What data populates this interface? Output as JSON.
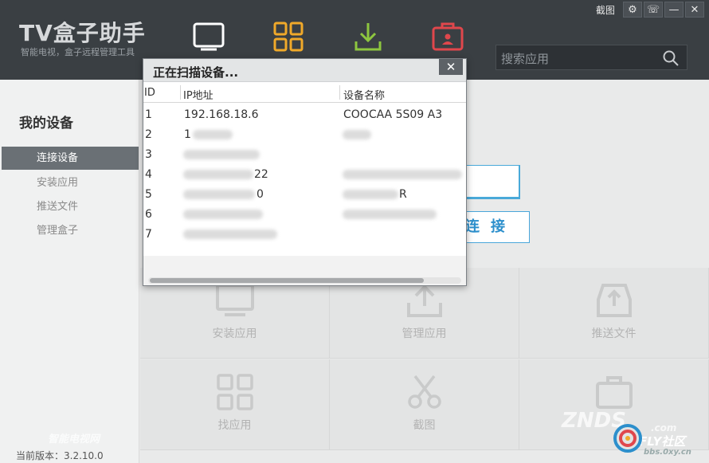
{
  "app": {
    "title": "TV盒子助手",
    "subtitle": "智能电视，盒子远程管理工具"
  },
  "window_controls": {
    "screenshot_label": "截图",
    "settings": "⚙",
    "feedback": "☏",
    "minimize": "—",
    "close": "✕"
  },
  "search": {
    "placeholder": "搜索应用"
  },
  "sidebar": {
    "title": "我的设备",
    "items": [
      {
        "label": "连接设备",
        "active": true
      },
      {
        "label": "安装应用",
        "active": false
      },
      {
        "label": "推送文件",
        "active": false
      },
      {
        "label": "管理盒子",
        "active": false
      }
    ],
    "version": "当前版本：3.2.10.0"
  },
  "main": {
    "connect_label": "连接",
    "tiles": [
      {
        "label": "安装应用",
        "icon": "monitor-icon"
      },
      {
        "label": "管理应用",
        "icon": "upload-icon"
      },
      {
        "label": "推送文件",
        "icon": "inbox-upload-icon"
      },
      {
        "label": "找应用",
        "icon": "grid-icon"
      },
      {
        "label": "截图",
        "icon": "scissors-icon"
      },
      {
        "label": "",
        "icon": "toolbox-icon"
      }
    ]
  },
  "dialog": {
    "title": "正在扫描设备...",
    "close": "✕",
    "columns": [
      "ID",
      "IP地址",
      "设备名称"
    ],
    "rows": [
      {
        "id": "1",
        "ip": "192.168.18.6",
        "name": "COOCAA 5S09 A3"
      },
      {
        "id": "2",
        "ip": "1",
        "name": ""
      },
      {
        "id": "3",
        "ip": "",
        "name": ""
      },
      {
        "id": "4",
        "ip": "22",
        "name": ""
      },
      {
        "id": "5",
        "ip": "0",
        "name": "R"
      },
      {
        "id": "6",
        "ip": "",
        "name": ""
      },
      {
        "id": "7",
        "ip": "",
        "name": ""
      }
    ]
  },
  "watermarks": {
    "left": "智能电视网",
    "right_brand": "ZNDS",
    "right_com": ".com",
    "fly": "FLY社区",
    "fly_url": "bbs.0xy.cn"
  },
  "colors": {
    "header_bg": "#3a3f43",
    "active_item": "#6a7075",
    "accent_blue": "#2c8fcc",
    "tv_icon": "#ffffff",
    "apps_icon": "#f0a92a",
    "download_icon": "#8dc63f",
    "toolbox_icon": "#e0474c"
  }
}
